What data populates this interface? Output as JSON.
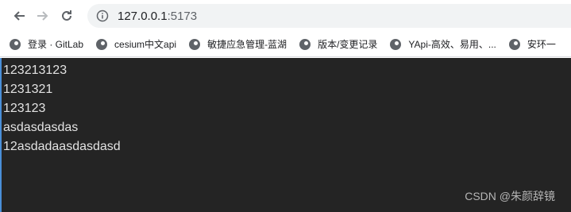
{
  "browser": {
    "url_host": "127.0.0.1",
    "url_port": ":5173",
    "bookmarks": [
      {
        "label": "登录 · GitLab"
      },
      {
        "label": "cesium中文api"
      },
      {
        "label": "敏捷应急管理-蓝湖"
      },
      {
        "label": "版本/变更记录"
      },
      {
        "label": "YApi-高效、易用、..."
      },
      {
        "label": "安环一"
      }
    ]
  },
  "page": {
    "lines": [
      "123213123",
      "1231321",
      "123123",
      "asdasdasdas",
      "12asdadaasdasdasd"
    ]
  },
  "watermark": "CSDN @朱颜辞镜"
}
